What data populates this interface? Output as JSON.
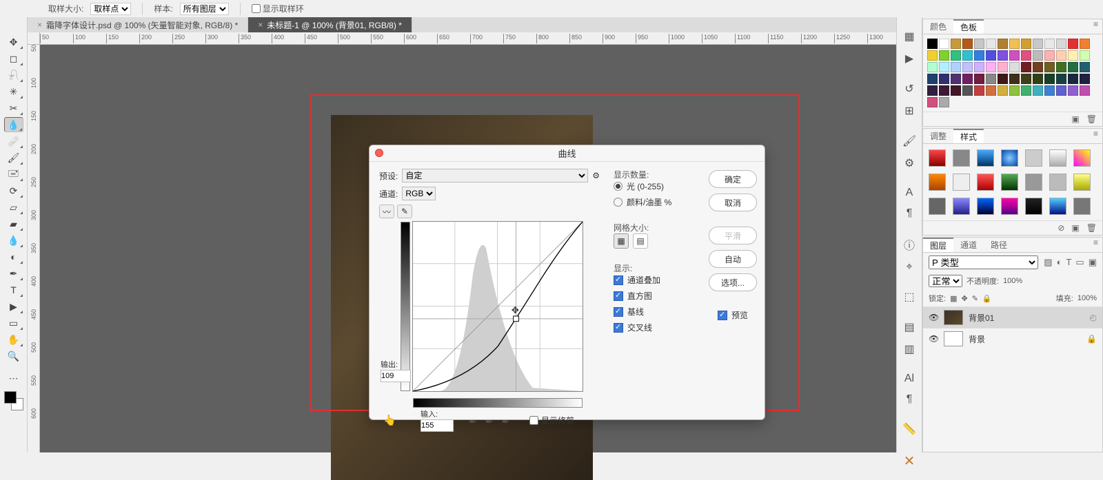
{
  "options_bar": {
    "sample_size_label": "取样大小:",
    "sample_size_value": "取样点",
    "sample_label": "样本:",
    "sample_value": "所有图层",
    "show_ring": "显示取样环"
  },
  "tabs": [
    {
      "label": "霜降字体设计.psd @ 100% (矢量智能对象, RGB/8) *"
    },
    {
      "label": "未标题-1 @ 100% (背景01, RGB/8) *"
    }
  ],
  "ruler_ticks_h": [
    "50",
    "100",
    "150",
    "200",
    "250",
    "300",
    "350",
    "400",
    "450",
    "500",
    "550",
    "600",
    "650",
    "700",
    "750",
    "800",
    "850",
    "900",
    "950",
    "1000",
    "1050",
    "1100",
    "1150",
    "1200",
    "1250",
    "1300"
  ],
  "ruler_ticks_v": [
    "50",
    "100",
    "150",
    "200",
    "250",
    "300",
    "350",
    "400",
    "450",
    "500",
    "550",
    "600"
  ],
  "dialog": {
    "title": "曲线",
    "preset_label": "预设:",
    "preset_value": "自定",
    "channel_label": "通道:",
    "channel_value": "RGB",
    "output_label": "输出:",
    "output_value": "109",
    "input_label": "输入:",
    "input_value": "155",
    "show_clip": "显示修剪",
    "display_amount_label": "显示数量:",
    "opt_light": "光 (0-255)",
    "opt_ink": "颜料/油墨 %",
    "grid_size_label": "网格大小:",
    "show_label": "显示:",
    "chk_channel_overlay": "通道叠加",
    "chk_histogram": "直方图",
    "chk_baseline": "基线",
    "chk_intersection": "交叉线",
    "chk_preview": "预览",
    "btn_ok": "确定",
    "btn_cancel": "取消",
    "btn_smooth": "平滑",
    "btn_auto": "自动",
    "btn_options": "选项..."
  },
  "panels": {
    "color_tab": "颜色",
    "swatches_tab": "色板",
    "adjust_tab": "调整",
    "styles_tab": "样式",
    "layers_tab": "图层",
    "channels_tab": "通道",
    "paths_tab": "路径",
    "kind_label": "P 类型",
    "blend_mode": "正常",
    "opacity_label": "不透明度:",
    "opacity_value": "100%",
    "lock_label": "锁定:",
    "fill_label": "填充:",
    "fill_value": "100%",
    "layer_bg01": "背景01",
    "layer_bg": "背景"
  },
  "swatch_colors": [
    "#000",
    "#fff",
    "#c79a3a",
    "#b55b1a",
    "#c7c7c7",
    "#e6e6e6",
    "#b08030",
    "#f0c050",
    "#d0a030",
    "#c8c8c8",
    "#e8e8e8",
    "#d8d8d8",
    "#e53030",
    "#f08030",
    "#f0d030",
    "#80d030",
    "#30c080",
    "#30c0d0",
    "#3080e0",
    "#5050e0",
    "#8050e0",
    "#d050c0",
    "#e05080",
    "#bbb",
    "#ffb0b0",
    "#ffd0b0",
    "#fff0b0",
    "#d0ffb0",
    "#b0ffd0",
    "#b0f0ff",
    "#b0d0ff",
    "#c0c0ff",
    "#d0b0ff",
    "#ffb0f0",
    "#ffb0d0",
    "#ddd",
    "#702020",
    "#704020",
    "#706020",
    "#407020",
    "#207040",
    "#206070",
    "#204070",
    "#303070",
    "#503070",
    "#702060",
    "#702040",
    "#888",
    "#401818",
    "#403018",
    "#404018",
    "#304018",
    "#184028",
    "#184040",
    "#182840",
    "#202040",
    "#302040",
    "#401838",
    "#401828",
    "#555",
    "#c04040",
    "#d07040",
    "#d0b040",
    "#90c040",
    "#40b070",
    "#40b0c0",
    "#4080d0",
    "#6060d0",
    "#9060d0",
    "#c050b0",
    "#d05080",
    "#aaa"
  ],
  "chart_data": {
    "type": "line",
    "title": "曲线",
    "xlabel": "输入",
    "ylabel": "输出",
    "xlim": [
      0,
      255
    ],
    "ylim": [
      0,
      255
    ],
    "series": [
      {
        "name": "baseline",
        "x": [
          0,
          255
        ],
        "y": [
          0,
          255
        ]
      },
      {
        "name": "curve",
        "x": [
          0,
          64,
          128,
          155,
          192,
          255
        ],
        "y": [
          0,
          22,
          68,
          109,
          168,
          255
        ]
      }
    ],
    "current_point": {
      "x": 155,
      "y": 109
    },
    "histogram_peak_x": 100
  }
}
